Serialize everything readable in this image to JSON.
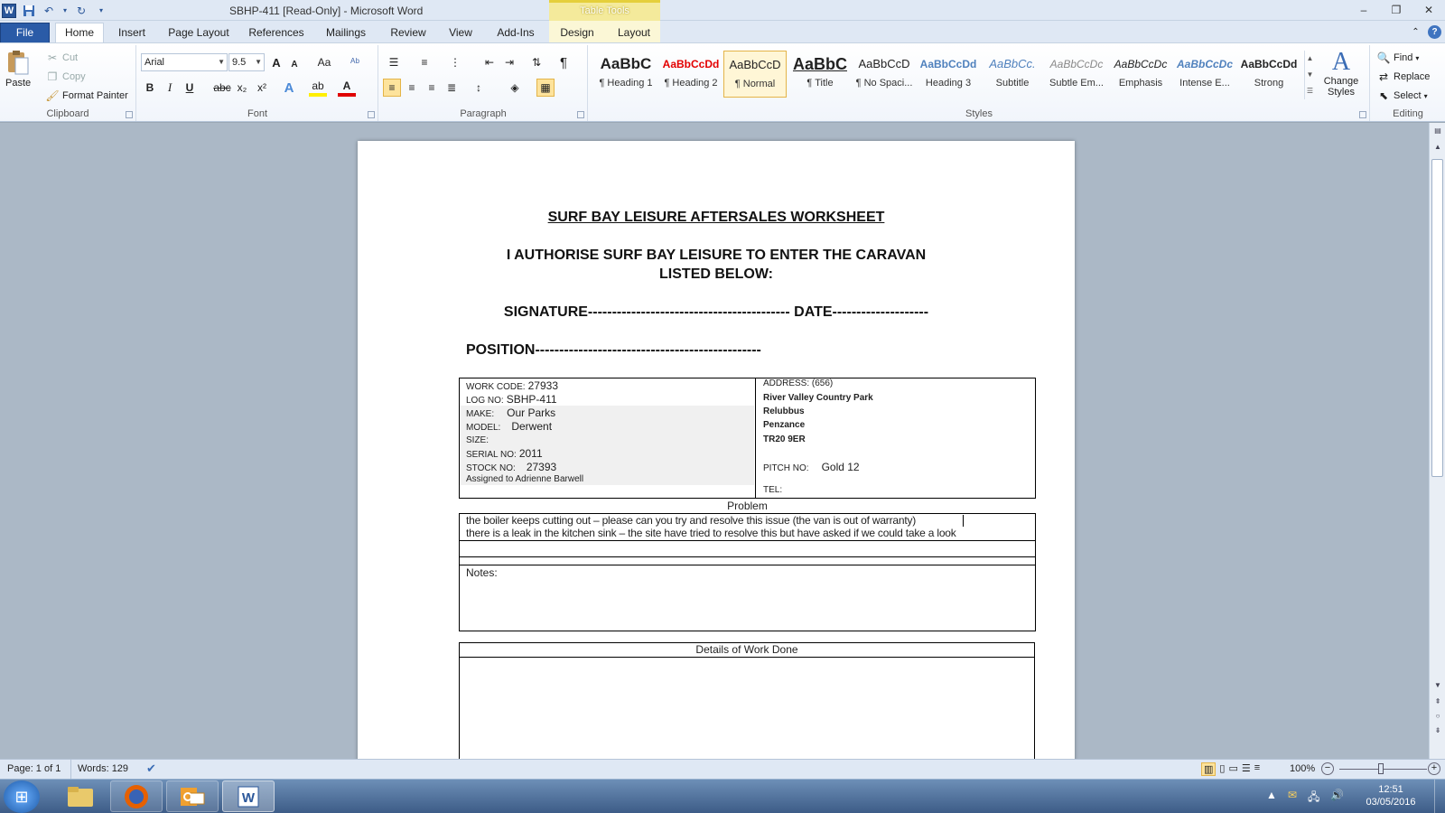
{
  "window": {
    "title": "SBHP-411 [Read-Only]  -  Microsoft Word",
    "table_tools": "Table Tools",
    "controls": {
      "minimize": "–",
      "restore": "❐",
      "close": "✕"
    }
  },
  "tabs": [
    "File",
    "Home",
    "Insert",
    "Page Layout",
    "References",
    "Mailings",
    "Review",
    "View",
    "Add-Ins",
    "Design",
    "Layout"
  ],
  "clipboard": {
    "paste": "Paste",
    "cut": "Cut",
    "copy": "Copy",
    "format_painter": "Format Painter",
    "label": "Clipboard"
  },
  "font": {
    "name": "Arial",
    "size": "9.5",
    "label": "Font",
    "grow": "A",
    "shrink": "A",
    "case": "Aa",
    "bold": "B",
    "italic": "I",
    "underline": "U",
    "strike": "abc",
    "subscript": "x₂",
    "superscript": "x²",
    "text_effects": "A",
    "highlight": "ab",
    "font_color": "A"
  },
  "paragraph": {
    "label": "Paragraph",
    "show_marks": "¶"
  },
  "styles": {
    "label": "Styles",
    "items": [
      {
        "preview": "AaBbC",
        "name": "¶ Heading 1"
      },
      {
        "preview": "AaBbCcDd",
        "name": "¶ Heading 2"
      },
      {
        "preview": "AaBbCcD",
        "name": "¶ Normal"
      },
      {
        "preview": "AaBbC",
        "name": "¶ Title"
      },
      {
        "preview": "AaBbCcD",
        "name": "¶ No Spaci..."
      },
      {
        "preview": "AaBbCcDd",
        "name": "Heading 3"
      },
      {
        "preview": "AaBbCc.",
        "name": "Subtitle"
      },
      {
        "preview": "AaBbCcDc",
        "name": "Subtle Em..."
      },
      {
        "preview": "AaBbCcDc",
        "name": "Emphasis"
      },
      {
        "preview": "AaBbCcDc",
        "name": "Intense E..."
      },
      {
        "preview": "AaBbCcDd",
        "name": "Strong"
      }
    ],
    "change_styles": "Change Styles"
  },
  "editing": {
    "label": "Editing",
    "find": "Find",
    "replace": "Replace",
    "select": "Select"
  },
  "document": {
    "heading": "SURF BAY LEISURE AFTERSALES WORKSHEET",
    "authorise_1": "I AUTHORISE SURF BAY LEISURE TO ENTER THE CARAVAN",
    "authorise_2": "LISTED BELOW:",
    "signature": "SIGNATURE------------------------------------------ DATE--------------------",
    "position": "POSITION-----------------------------------------------",
    "left": {
      "work_code_label": "WORK CODE:",
      "work_code": "27933",
      "log_no_label": "LOG NO:",
      "log_no": "SBHP-411",
      "make_label": "MAKE:",
      "make": "Our Parks",
      "model_label": "MODEL:",
      "model": "Derwent",
      "size_label": "SIZE:",
      "serial_label": "SERIAL NO:",
      "serial": "2011",
      "stock_label": "STOCK NO:",
      "stock": "27393",
      "assigned": "Assigned to Adrienne Barwell"
    },
    "right": {
      "address_label": "ADDRESS:  (656)",
      "address_1": "River Valley Country Park",
      "address_2": "Relubbus",
      "address_3": "Penzance",
      "address_4": "TR20 9ER",
      "pitch_label": "PITCH NO:",
      "pitch": "Gold 12",
      "tel_label": "TEL:"
    },
    "problem_header": "Problem",
    "problem_1": "the boiler keeps cutting out – please can you try and resolve this issue (the van is out of warranty)",
    "problem_2": "there is a leak in the kitchen sink – the site have tried to resolve this but have asked if we could take a look",
    "notes_label": "Notes:",
    "details_header": "Details of Work Done"
  },
  "status": {
    "page": "Page: 1 of 1",
    "words": "Words: 129",
    "zoom": "100%"
  },
  "taskbar": {
    "time": "12:51",
    "date": "03/05/2016"
  },
  "colors": {
    "file_tab": "#2a5ba7",
    "ribbon_bg": "#f1f5fb",
    "doc_bg": "#abb8c6",
    "selected_style": "#fff6d6"
  }
}
